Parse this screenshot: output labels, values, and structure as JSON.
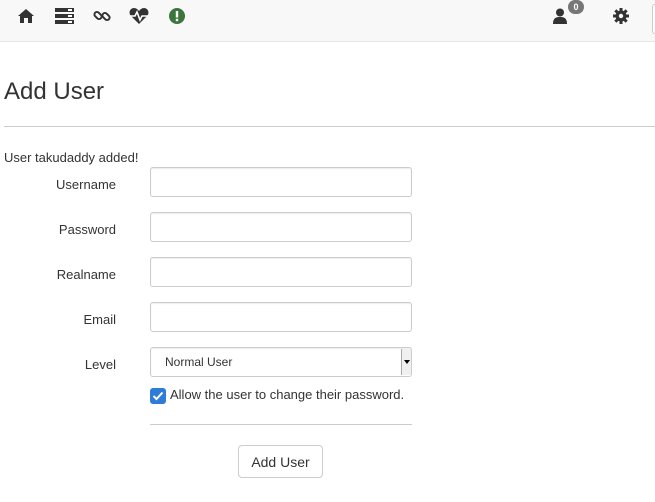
{
  "navbar": {
    "icons": [
      "home-icon",
      "server-icon",
      "link-icon",
      "heartbeat-icon",
      "alert-circle-icon",
      "user-icon",
      "gear-icon"
    ],
    "notification_count": "0",
    "colors": {
      "alert_icon": "#3c763d",
      "icon": "#333333"
    }
  },
  "page": {
    "title": "Add User",
    "flash_message": "User takudaddy added!"
  },
  "form": {
    "username_label": "Username",
    "username_value": "",
    "password_label": "Password",
    "password_value": "",
    "realname_label": "Realname",
    "realname_value": "",
    "email_label": "Email",
    "email_value": "",
    "level_label": "Level",
    "level_selected": "Normal User",
    "checkbox_checked": true,
    "checkbox_label": "Allow the user to change their password.",
    "submit_label": "Add User"
  },
  "colors": {
    "checkbox": "#2f7bd8",
    "border": "#cccccc",
    "navbar_bg": "#f8f8f8"
  }
}
